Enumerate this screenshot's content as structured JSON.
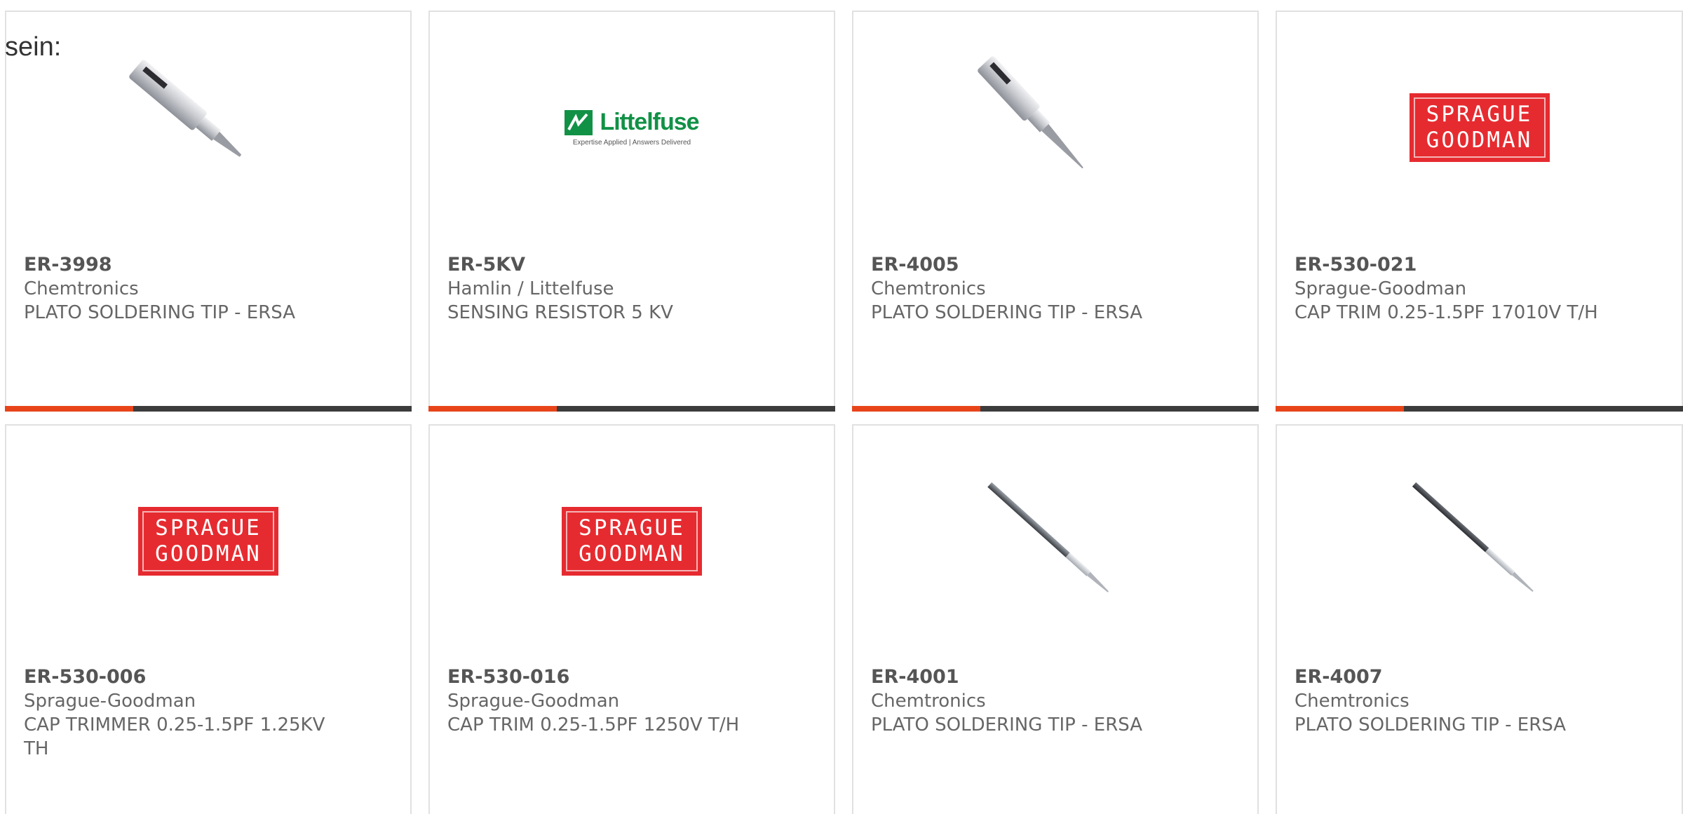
{
  "intro": {
    "text": "sein:"
  },
  "products": [
    {
      "part": "ER-3998",
      "maker": "Chemtronics",
      "desc": "PLATO SOLDERING TIP - ERSA",
      "image": "soldering-tip-thick"
    },
    {
      "part": "ER-5KV",
      "maker": "Hamlin / Littelfuse",
      "desc": "SENSING RESISTOR 5 KV",
      "image": "littelfuse-logo"
    },
    {
      "part": "ER-4005",
      "maker": "Chemtronics",
      "desc": "PLATO SOLDERING TIP - ERSA",
      "image": "soldering-tip-thick"
    },
    {
      "part": "ER-530-021",
      "maker": "Sprague-Goodman",
      "desc": "CAP TRIM 0.25-1.5PF 17010V T/H",
      "image": "sprague-goodman-logo"
    },
    {
      "part": "ER-530-006",
      "maker": "Sprague-Goodman",
      "desc": "CAP TRIMMER 0.25-1.5PF 1.25KV TH",
      "image": "sprague-goodman-logo"
    },
    {
      "part": "ER-530-016",
      "maker": "Sprague-Goodman",
      "desc": "CAP TRIM 0.25-1.5PF 1250V T/H",
      "image": "sprague-goodman-logo"
    },
    {
      "part": "ER-4001",
      "maker": "Chemtronics",
      "desc": "PLATO SOLDERING TIP - ERSA",
      "image": "soldering-tip-slim"
    },
    {
      "part": "ER-4007",
      "maker": "Chemtronics",
      "desc": "PLATO SOLDERING TIP - ERSA",
      "image": "soldering-tip-slim"
    }
  ],
  "logos": {
    "sprague_goodman": {
      "line1": "SPRAGUE",
      "line2": "GOODMAN"
    },
    "littelfuse": {
      "name": "Littelfuse",
      "tagline": "Expertise Applied | Answers Delivered"
    }
  },
  "colors": {
    "accent": "#e8441a",
    "bar": "#3c3c3c",
    "sprague_red": "#e62b30",
    "littelfuse_green": "#119146"
  }
}
